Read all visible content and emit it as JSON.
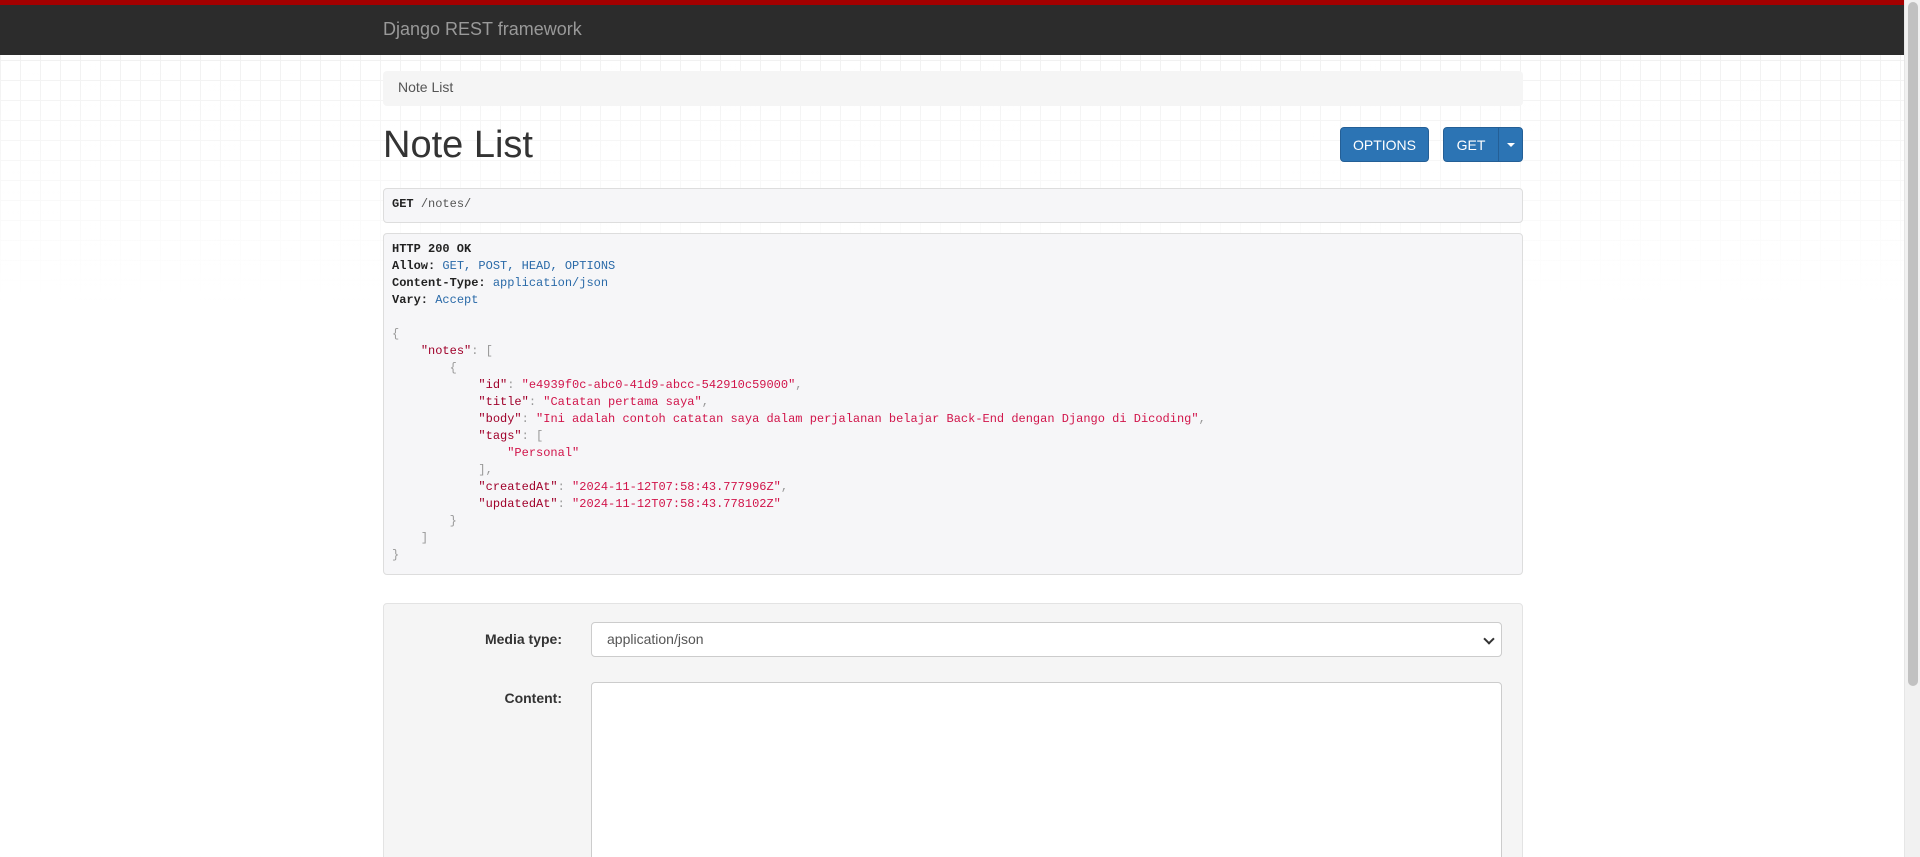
{
  "navbar": {
    "brand": "Django REST framework"
  },
  "breadcrumb": {
    "items": [
      {
        "label": "Note List"
      }
    ]
  },
  "page": {
    "title": "Note List"
  },
  "toolbar": {
    "options_label": "OPTIONS",
    "get_label": "GET"
  },
  "request": {
    "method": "GET",
    "path": "/notes/"
  },
  "response": {
    "status": "HTTP 200 OK",
    "headers": [
      {
        "key": "Allow:",
        "value": "GET, POST, HEAD, OPTIONS"
      },
      {
        "key": "Content-Type:",
        "value": "application/json"
      },
      {
        "key": "Vary:",
        "value": "Accept"
      }
    ],
    "body": {
      "notes_key": "\"notes\"",
      "note": {
        "id_key": "\"id\"",
        "id": "\"e4939f0c-abc0-41d9-abcc-542910c59000\"",
        "title_key": "\"title\"",
        "title": "\"Catatan pertama saya\"",
        "body_key": "\"body\"",
        "body": "\"Ini adalah contoh catatan saya dalam perjalanan belajar Back-End dengan Django di Dicoding\"",
        "tags_key": "\"tags\"",
        "tags": [
          "\"Personal\""
        ],
        "createdAt_key": "\"createdAt\"",
        "createdAt": "\"2024-11-12T07:58:43.777996Z\"",
        "updatedAt_key": "\"updatedAt\"",
        "updatedAt": "\"2024-11-12T07:58:43.778102Z\""
      }
    }
  },
  "form": {
    "media_type_label": "Media type:",
    "media_type_value": "application/json",
    "content_label": "Content:",
    "content_value": ""
  },
  "colors": {
    "accent": "#a30000",
    "navbar": "#2c2c2c",
    "button": "#2c74b4"
  }
}
